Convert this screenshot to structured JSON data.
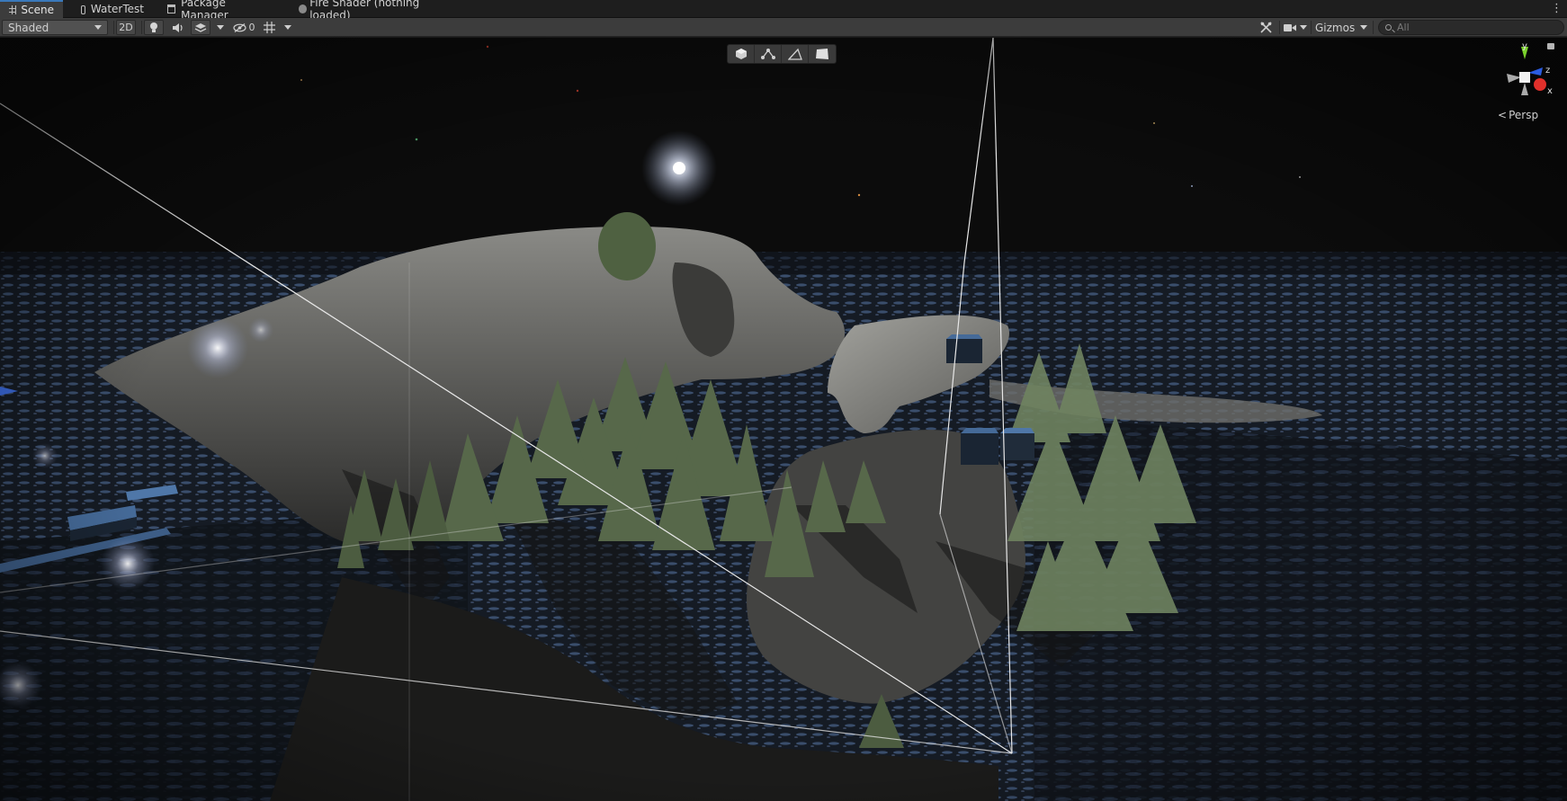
{
  "tabs": [
    {
      "label": "Scene",
      "icon": "grid-icon",
      "active": true
    },
    {
      "label": "WaterTest",
      "icon": "gamepad-icon",
      "active": false
    },
    {
      "label": "Package Manager",
      "icon": "package-icon",
      "active": false
    },
    {
      "label": "Fire Shader (nothing loaded)",
      "icon": "dot-icon",
      "active": false
    }
  ],
  "toolbar": {
    "draw_mode": "Shaded",
    "toggle_2d": "2D",
    "hidden_count": "0",
    "gizmos_label": "Gizmos",
    "search_placeholder": "All"
  },
  "viewport": {
    "projection_label": "Persp",
    "axes": {
      "y": "y",
      "z": "z",
      "x": "x"
    },
    "axis_colors": {
      "x": "#e0302b",
      "y": "#7ad12b",
      "z": "#2b5ce0"
    }
  },
  "colors": {
    "accent": "#3a79bb",
    "toolbar_bg": "#3c3c3c",
    "tab_bg": "#1e1e1e"
  }
}
